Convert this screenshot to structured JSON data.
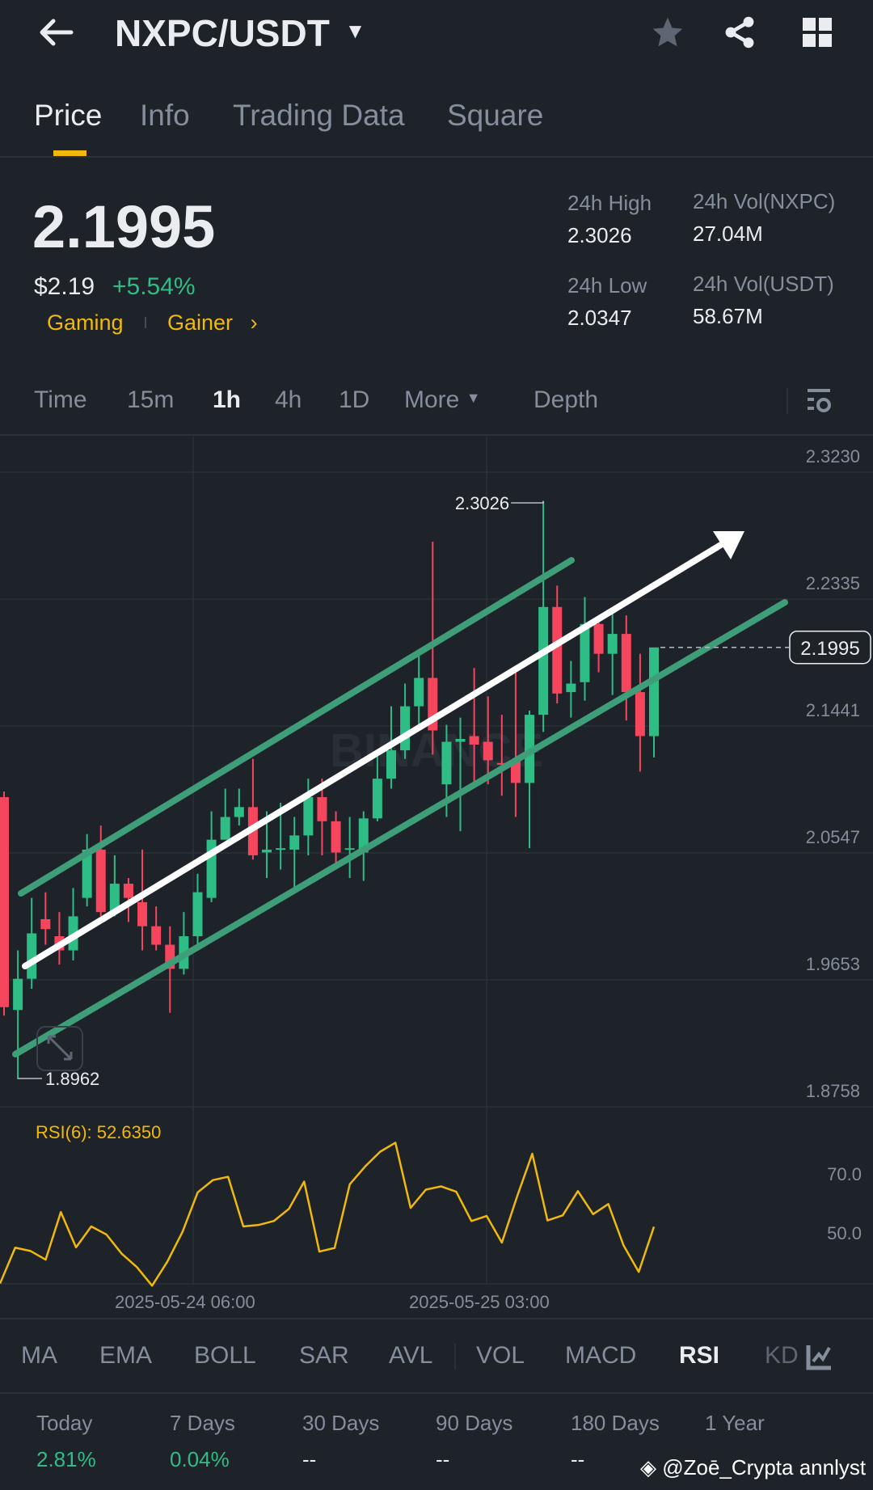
{
  "header": {
    "title": "NXPC/USDT"
  },
  "tabs": [
    {
      "label": "Price",
      "active": true
    },
    {
      "label": "Info"
    },
    {
      "label": "Trading Data"
    },
    {
      "label": "Square"
    }
  ],
  "ticker": {
    "last_price": "2.1995",
    "usd_price": "$2.19",
    "change": "+5.54%",
    "tags": [
      "Gaming",
      "Gainer"
    ],
    "high_label": "24h High",
    "high": "2.3026",
    "low_label": "24h Low",
    "low": "2.0347",
    "vol_base_label": "24h Vol(NXPC)",
    "vol_base": "27.04M",
    "vol_quote_label": "24h Vol(USDT)",
    "vol_quote": "58.67M"
  },
  "intervals": [
    "Time",
    "15m",
    "1h",
    "4h",
    "1D",
    "More",
    "Depth"
  ],
  "active_interval": "1h",
  "colors": {
    "up": "#2ebd85",
    "down": "#f6465d",
    "accent": "#f0b90b",
    "channel": "#3f9e7a"
  },
  "chart_data": {
    "type": "candlestick",
    "y_ticks": [
      "2.3230",
      "2.2335",
      "2.1441",
      "2.0547",
      "1.9653",
      "1.8758"
    ],
    "ylim": [
      1.8758,
      2.323
    ],
    "x_ticks": [
      "2025-05-24 06:00",
      "2025-05-25 03:00"
    ],
    "high_marker": "2.3026",
    "low_marker": "1.8962",
    "current_price": "2.1995",
    "watermark": "BINANCE",
    "ohlc": [
      [
        2.094,
        2.098,
        1.94,
        1.946
      ],
      [
        1.944,
        1.986,
        1.896,
        1.966
      ],
      [
        1.966,
        2.023,
        1.959,
        1.998
      ],
      [
        2.008,
        2.027,
        1.99,
        2.001
      ],
      [
        1.996,
        2.013,
        1.976,
        1.986
      ],
      [
        1.986,
        2.03,
        1.979,
        2.01
      ],
      [
        2.023,
        2.068,
        2.017,
        2.057
      ],
      [
        2.057,
        2.074,
        2.01,
        2.013
      ],
      [
        2.013,
        2.053,
        2.01,
        2.033
      ],
      [
        2.033,
        2.037,
        2.006,
        2.023
      ],
      [
        2.02,
        2.057,
        1.986,
        2.003
      ],
      [
        2.003,
        2.017,
        1.986,
        1.99
      ],
      [
        1.99,
        2.003,
        1.942,
        1.973
      ],
      [
        1.973,
        2.013,
        1.969,
        1.996
      ],
      [
        1.996,
        2.04,
        1.986,
        2.027
      ],
      [
        2.023,
        2.084,
        2.02,
        2.064
      ],
      [
        2.064,
        2.1,
        2.064,
        2.08
      ],
      [
        2.08,
        2.1,
        2.074,
        2.087
      ],
      [
        2.087,
        2.121,
        2.05,
        2.053
      ],
      [
        2.055,
        2.084,
        2.037,
        2.057
      ],
      [
        2.057,
        2.09,
        2.043,
        2.058
      ],
      [
        2.057,
        2.08,
        2.03,
        2.067
      ],
      [
        2.067,
        2.107,
        2.053,
        2.094
      ],
      [
        2.094,
        2.107,
        2.053,
        2.077
      ],
      [
        2.077,
        2.084,
        2.043,
        2.055
      ],
      [
        2.057,
        2.08,
        2.037,
        2.058
      ],
      [
        2.055,
        2.084,
        2.035,
        2.079
      ],
      [
        2.079,
        2.124,
        2.077,
        2.107
      ],
      [
        2.107,
        2.158,
        2.1,
        2.127
      ],
      [
        2.127,
        2.174,
        2.121,
        2.158
      ],
      [
        2.158,
        2.194,
        2.141,
        2.178
      ],
      [
        2.178,
        2.274,
        2.124,
        2.141
      ],
      [
        2.103,
        2.145,
        2.08,
        2.133
      ],
      [
        2.133,
        2.15,
        2.07,
        2.135
      ],
      [
        2.137,
        2.185,
        2.103,
        2.131
      ],
      [
        2.133,
        2.165,
        2.103,
        2.12
      ],
      [
        2.118,
        2.152,
        2.095,
        2.117
      ],
      [
        2.12,
        2.183,
        2.08,
        2.104
      ],
      [
        2.104,
        2.155,
        2.058,
        2.152
      ],
      [
        2.152,
        2.3026,
        2.14,
        2.228
      ],
      [
        2.228,
        2.243,
        2.16,
        2.167
      ],
      [
        2.168,
        2.19,
        2.15,
        2.174
      ],
      [
        2.175,
        2.235,
        2.162,
        2.216
      ],
      [
        2.216,
        2.218,
        2.182,
        2.195
      ],
      [
        2.195,
        2.225,
        2.166,
        2.209
      ],
      [
        2.209,
        2.222,
        2.148,
        2.168
      ],
      [
        2.168,
        2.195,
        2.112,
        2.137
      ],
      [
        2.137,
        2.183,
        2.122,
        2.1995
      ]
    ],
    "rsi": {
      "label": "RSI(6): 52.6350",
      "ticks": [
        "70.0",
        "50.0"
      ],
      "values": [
        33.6,
        45.6,
        44.5,
        41.6,
        57.5,
        45.7,
        52.7,
        50.0,
        43.6,
        39.1,
        32.9,
        40.9,
        50.9,
        64.1,
        68.2,
        69.3,
        52.7,
        53.2,
        54.5,
        58.6,
        67.7,
        44.3,
        45.5,
        66.8,
        72.7,
        77.7,
        80.7,
        58.9,
        65.0,
        66.1,
        64.3,
        54.5,
        56.2,
        47.3,
        62.7,
        77.0,
        54.7,
        56.4,
        64.5,
        56.8,
        60.2,
        46.4,
        37.5,
        52.6
      ]
    }
  },
  "indicators": [
    "MA",
    "EMA",
    "BOLL",
    "SAR",
    "AVL",
    "VOL",
    "MACD",
    "RSI",
    "KD"
  ],
  "active_indicator": "RSI",
  "performance": [
    {
      "label": "Today",
      "value": "2.81%"
    },
    {
      "label": "7 Days",
      "value": "0.04%"
    },
    {
      "label": "30 Days",
      "value": "--"
    },
    {
      "label": "90 Days",
      "value": "--"
    },
    {
      "label": "180 Days",
      "value": "--"
    },
    {
      "label": "1 Year",
      "value": ""
    }
  ],
  "watermark": "@Zoē_Crypta annlyst"
}
